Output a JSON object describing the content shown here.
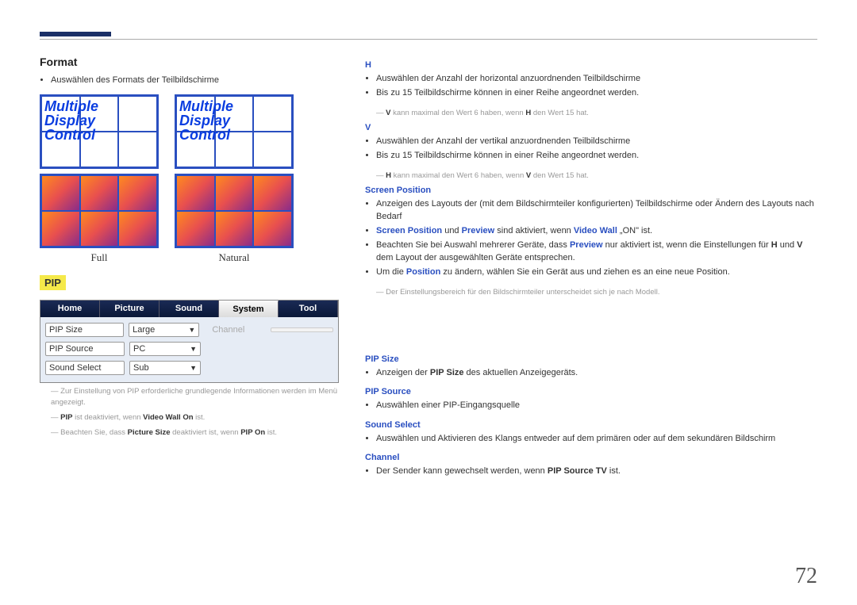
{
  "page_number": "72",
  "left": {
    "format_heading": "Format",
    "format_desc": "Auswählen des Formats der Teilbildschirme",
    "mdc_text": "Multiple\nDisplay\nControl",
    "full_label": "Full",
    "natural_label": "Natural",
    "pip_heading": "PIP",
    "tabs": {
      "home": "Home",
      "picture": "Picture",
      "sound": "Sound",
      "system": "System",
      "tool": "Tool"
    },
    "rows": {
      "pip_size_label": "PIP Size",
      "pip_size_val": "Large",
      "channel_label": "Channel",
      "channel_val": "",
      "pip_source_label": "PIP Source",
      "pip_source_val": "PC",
      "sound_select_label": "Sound Select",
      "sound_select_val": "Sub"
    },
    "notes": {
      "n1": "Zur Einstellung von PIP erforderliche grundlegende Informationen werden im Menü angezeigt.",
      "n2_pre": "PIP",
      "n2_mid": " ist deaktiviert, wenn ",
      "n2_vw": "Video Wall On",
      "n2_post": " ist.",
      "n3_pre": "Beachten Sie, dass ",
      "n3_ps": "Picture Size",
      "n3_mid": " deaktiviert ist, wenn ",
      "n3_pip": "PIP On",
      "n3_post": " ist."
    }
  },
  "right": {
    "h_heading": "H",
    "h_li1": "Auswählen der Anzahl der horizontal anzuordnenden Teilbildschirme",
    "h_li2": "Bis zu 15 Teilbildschirme können in einer Reihe angeordnet werden.",
    "h_note_pre": "",
    "h_note_v": "V",
    "h_note_mid": " kann maximal den Wert 6 haben, wenn ",
    "h_note_h": "H",
    "h_note_post": " den Wert 15 hat.",
    "v_heading": "V",
    "v_li1": "Auswählen der Anzahl der vertikal anzuordnenden Teilbildschirme",
    "v_li2": "Bis zu 15 Teilbildschirme können in einer Reihe angeordnet werden.",
    "v_note_pre": "",
    "v_note_h": "H",
    "v_note_mid": " kann maximal den Wert 6 haben, wenn ",
    "v_note_v": "V",
    "v_note_post": " den Wert 15 hat.",
    "sp_heading": "Screen Position",
    "sp_li1": "Anzeigen des Layouts der (mit dem Bildschirmteiler konfigurierten) Teilbildschirme oder Ändern des Layouts nach Bedarf",
    "sp_li2_a": "Screen Position",
    "sp_li2_b": " und ",
    "sp_li2_c": "Preview",
    "sp_li2_d": " sind aktiviert, wenn ",
    "sp_li2_e": "Video Wall",
    "sp_li2_f": " „ON\" ist.",
    "sp_li3_a": "Beachten Sie bei Auswahl mehrerer Geräte, dass ",
    "sp_li3_b": "Preview",
    "sp_li3_c": " nur aktiviert ist, wenn die Einstellungen für ",
    "sp_li3_d": "H",
    "sp_li3_e": " und ",
    "sp_li3_f": "V",
    "sp_li3_g": " dem Layout der ausgewählten Geräte entsprechen.",
    "sp_li4_a": "Um die ",
    "sp_li4_b": "Position",
    "sp_li4_c": " zu ändern, wählen Sie ein Gerät aus und ziehen es an eine neue Position.",
    "sp_note": "Der Einstellungsbereich für den Bildschirmteiler unterscheidet sich je nach Modell.",
    "psize_heading": "PIP Size",
    "psize_li_a": "Anzeigen der ",
    "psize_li_b": "PIP Size",
    "psize_li_c": " des aktuellen Anzeigegeräts.",
    "psource_heading": "PIP Source",
    "psource_li": "Auswählen einer PIP-Eingangsquelle",
    "ss_heading": "Sound Select",
    "ss_li": "Auswählen und Aktivieren des Klangs entweder auf dem primären oder auf dem sekundären Bildschirm",
    "ch_heading": "Channel",
    "ch_li_a": "Der Sender kann gewechselt werden, wenn ",
    "ch_li_b": "PIP Source TV",
    "ch_li_c": " ist."
  }
}
